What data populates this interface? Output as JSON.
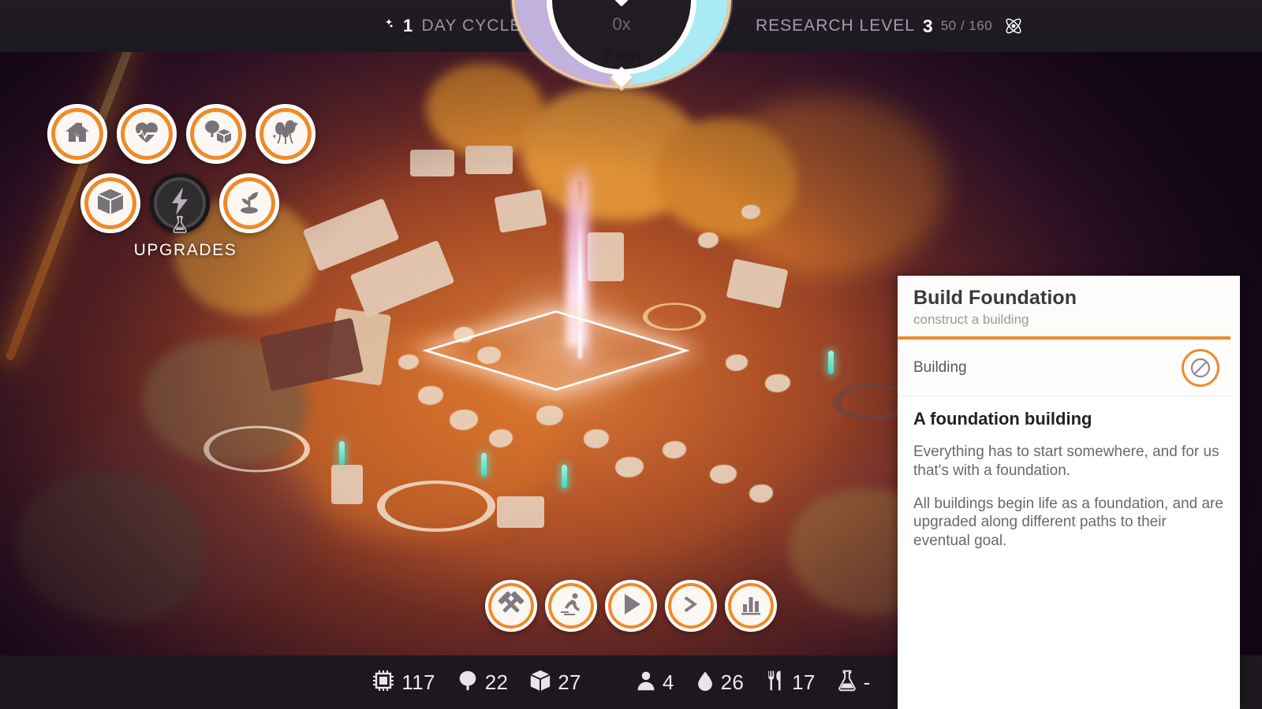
{
  "topbar": {
    "day_cycle": {
      "icon": "moon-icon",
      "value": "1",
      "label": "DAY CYCLE"
    },
    "research": {
      "label": "RESEARCH LEVEL",
      "level": "3",
      "progress": "50 / 160",
      "icon": "atom-icon"
    }
  },
  "day_dial": {
    "speed": "0x",
    "time": "7 am",
    "night_color": "#c2b0dd",
    "day_color": "#a9eaf5",
    "ring_color": "#f0c79a"
  },
  "upgrades": {
    "label": "UPGRADES",
    "buttons": [
      {
        "name": "housing-upgrade",
        "icon": "house-icon",
        "locked": false
      },
      {
        "name": "health-upgrade",
        "icon": "heart-pulse-icon",
        "locked": false
      },
      {
        "name": "resources-upgrade",
        "icon": "tree-crate-icon",
        "locked": false
      },
      {
        "name": "entertainment-upgrade",
        "icon": "balloons-icon",
        "locked": false
      },
      {
        "name": "storage-upgrade",
        "icon": "crate-icon",
        "locked": false
      },
      {
        "name": "power-upgrade",
        "icon": "lightning-icon",
        "locked": true,
        "lock_badge": "flask-icon"
      },
      {
        "name": "growth-upgrade",
        "icon": "sprout-icon",
        "locked": false
      }
    ]
  },
  "actions": [
    {
      "name": "build-button",
      "icon": "hammers-icon"
    },
    {
      "name": "worker-speed-button",
      "icon": "runner-icon"
    },
    {
      "name": "play-button",
      "icon": "play-icon"
    },
    {
      "name": "fast-forward-button",
      "icon": "chevron-right-icon"
    },
    {
      "name": "statistics-button",
      "icon": "bar-chart-icon"
    }
  ],
  "resources": {
    "left": [
      {
        "name": "circuits",
        "icon": "chip-icon",
        "value": "117"
      },
      {
        "name": "wood",
        "icon": "tree-icon",
        "value": "22"
      },
      {
        "name": "crates",
        "icon": "crate-icon",
        "value": "27"
      }
    ],
    "right": [
      {
        "name": "population",
        "icon": "person-icon",
        "value": "4"
      },
      {
        "name": "water",
        "icon": "water-drop-icon",
        "value": "26"
      },
      {
        "name": "food",
        "icon": "cutlery-icon",
        "value": "17"
      },
      {
        "name": "science",
        "icon": "flask-icon",
        "value": "-"
      }
    ]
  },
  "info_panel": {
    "title": "Build Foundation",
    "subtitle": "construct a building",
    "row_label": "Building",
    "row_icon": "prohibited-icon",
    "heading": "A foundation building",
    "paragraph1": "Everything has to start somewhere, and for us that's with a foundation.",
    "paragraph2": "All buildings begin life as a foundation, and are upgraded along different paths to their eventual goal.",
    "accent_color": "#ef8a2a"
  }
}
